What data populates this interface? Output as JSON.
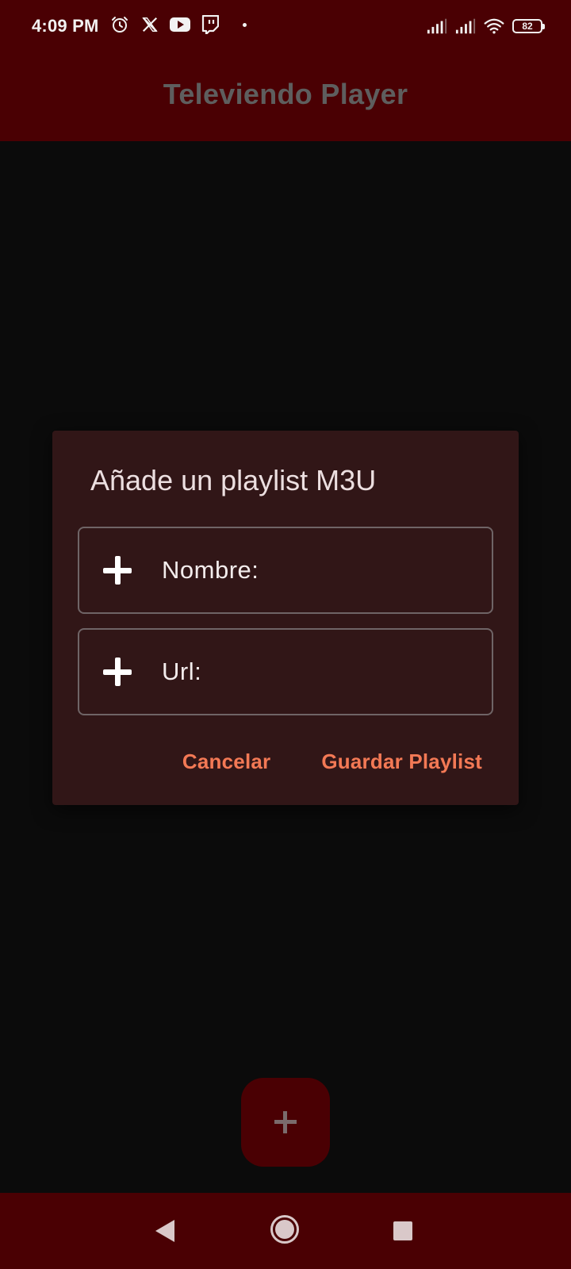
{
  "status_bar": {
    "time": "4:09 PM",
    "battery": "82",
    "icons_left": [
      "alarm-icon",
      "x-icon",
      "youtube-icon",
      "twitch-icon",
      "notification-dot"
    ],
    "icons_right": [
      "signal-icon",
      "signal-icon",
      "wifi-icon",
      "battery-icon"
    ]
  },
  "app_bar": {
    "title": "Televiendo Player"
  },
  "dialog": {
    "title": "Añade un playlist M3U",
    "fields": [
      {
        "icon": "plus-icon",
        "label": "Nombre:"
      },
      {
        "icon": "plus-icon",
        "label": "Url:"
      }
    ],
    "actions": {
      "cancel": "Cancelar",
      "save": "Guardar Playlist"
    }
  },
  "fab": {
    "icon": "plus-icon"
  },
  "nav_bar": {
    "icons": [
      "back-icon",
      "home-icon",
      "recents-icon"
    ]
  },
  "colors": {
    "bar": "#4a0003",
    "background": "#0b0b0b",
    "dialog": "#311617",
    "accent": "#f37955"
  }
}
